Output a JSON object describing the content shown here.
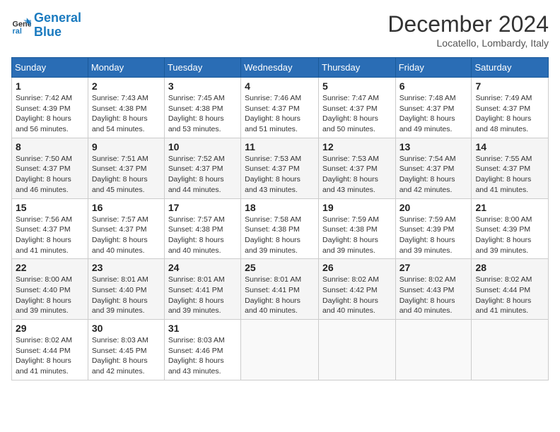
{
  "header": {
    "logo_line1": "General",
    "logo_line2": "Blue",
    "month_title": "December 2024",
    "location": "Locatello, Lombardy, Italy"
  },
  "weekdays": [
    "Sunday",
    "Monday",
    "Tuesday",
    "Wednesday",
    "Thursday",
    "Friday",
    "Saturday"
  ],
  "weeks": [
    [
      {
        "day": "1",
        "sunrise": "7:42 AM",
        "sunset": "4:39 PM",
        "daylight": "8 hours and 56 minutes."
      },
      {
        "day": "2",
        "sunrise": "7:43 AM",
        "sunset": "4:38 PM",
        "daylight": "8 hours and 54 minutes."
      },
      {
        "day": "3",
        "sunrise": "7:45 AM",
        "sunset": "4:38 PM",
        "daylight": "8 hours and 53 minutes."
      },
      {
        "day": "4",
        "sunrise": "7:46 AM",
        "sunset": "4:37 PM",
        "daylight": "8 hours and 51 minutes."
      },
      {
        "day": "5",
        "sunrise": "7:47 AM",
        "sunset": "4:37 PM",
        "daylight": "8 hours and 50 minutes."
      },
      {
        "day": "6",
        "sunrise": "7:48 AM",
        "sunset": "4:37 PM",
        "daylight": "8 hours and 49 minutes."
      },
      {
        "day": "7",
        "sunrise": "7:49 AM",
        "sunset": "4:37 PM",
        "daylight": "8 hours and 48 minutes."
      }
    ],
    [
      {
        "day": "8",
        "sunrise": "7:50 AM",
        "sunset": "4:37 PM",
        "daylight": "8 hours and 46 minutes."
      },
      {
        "day": "9",
        "sunrise": "7:51 AM",
        "sunset": "4:37 PM",
        "daylight": "8 hours and 45 minutes."
      },
      {
        "day": "10",
        "sunrise": "7:52 AM",
        "sunset": "4:37 PM",
        "daylight": "8 hours and 44 minutes."
      },
      {
        "day": "11",
        "sunrise": "7:53 AM",
        "sunset": "4:37 PM",
        "daylight": "8 hours and 43 minutes."
      },
      {
        "day": "12",
        "sunrise": "7:53 AM",
        "sunset": "4:37 PM",
        "daylight": "8 hours and 43 minutes."
      },
      {
        "day": "13",
        "sunrise": "7:54 AM",
        "sunset": "4:37 PM",
        "daylight": "8 hours and 42 minutes."
      },
      {
        "day": "14",
        "sunrise": "7:55 AM",
        "sunset": "4:37 PM",
        "daylight": "8 hours and 41 minutes."
      }
    ],
    [
      {
        "day": "15",
        "sunrise": "7:56 AM",
        "sunset": "4:37 PM",
        "daylight": "8 hours and 41 minutes."
      },
      {
        "day": "16",
        "sunrise": "7:57 AM",
        "sunset": "4:37 PM",
        "daylight": "8 hours and 40 minutes."
      },
      {
        "day": "17",
        "sunrise": "7:57 AM",
        "sunset": "4:38 PM",
        "daylight": "8 hours and 40 minutes."
      },
      {
        "day": "18",
        "sunrise": "7:58 AM",
        "sunset": "4:38 PM",
        "daylight": "8 hours and 39 minutes."
      },
      {
        "day": "19",
        "sunrise": "7:59 AM",
        "sunset": "4:38 PM",
        "daylight": "8 hours and 39 minutes."
      },
      {
        "day": "20",
        "sunrise": "7:59 AM",
        "sunset": "4:39 PM",
        "daylight": "8 hours and 39 minutes."
      },
      {
        "day": "21",
        "sunrise": "8:00 AM",
        "sunset": "4:39 PM",
        "daylight": "8 hours and 39 minutes."
      }
    ],
    [
      {
        "day": "22",
        "sunrise": "8:00 AM",
        "sunset": "4:40 PM",
        "daylight": "8 hours and 39 minutes."
      },
      {
        "day": "23",
        "sunrise": "8:01 AM",
        "sunset": "4:40 PM",
        "daylight": "8 hours and 39 minutes."
      },
      {
        "day": "24",
        "sunrise": "8:01 AM",
        "sunset": "4:41 PM",
        "daylight": "8 hours and 39 minutes."
      },
      {
        "day": "25",
        "sunrise": "8:01 AM",
        "sunset": "4:41 PM",
        "daylight": "8 hours and 40 minutes."
      },
      {
        "day": "26",
        "sunrise": "8:02 AM",
        "sunset": "4:42 PM",
        "daylight": "8 hours and 40 minutes."
      },
      {
        "day": "27",
        "sunrise": "8:02 AM",
        "sunset": "4:43 PM",
        "daylight": "8 hours and 40 minutes."
      },
      {
        "day": "28",
        "sunrise": "8:02 AM",
        "sunset": "4:44 PM",
        "daylight": "8 hours and 41 minutes."
      }
    ],
    [
      {
        "day": "29",
        "sunrise": "8:02 AM",
        "sunset": "4:44 PM",
        "daylight": "8 hours and 41 minutes."
      },
      {
        "day": "30",
        "sunrise": "8:03 AM",
        "sunset": "4:45 PM",
        "daylight": "8 hours and 42 minutes."
      },
      {
        "day": "31",
        "sunrise": "8:03 AM",
        "sunset": "4:46 PM",
        "daylight": "8 hours and 43 minutes."
      },
      null,
      null,
      null,
      null
    ]
  ],
  "labels": {
    "sunrise": "Sunrise:",
    "sunset": "Sunset:",
    "daylight": "Daylight:"
  }
}
